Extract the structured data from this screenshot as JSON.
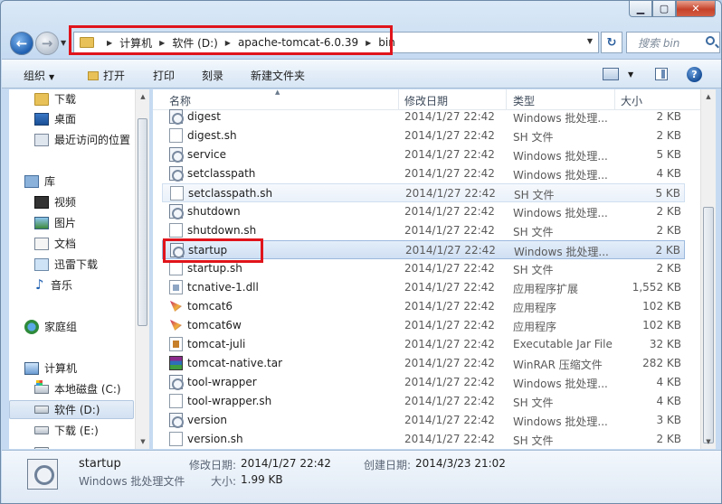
{
  "address": {
    "crumbs": [
      "计算机",
      "软件 (D:)",
      "apache-tomcat-6.0.39",
      "bin"
    ]
  },
  "search": {
    "placeholder": "搜索 bin"
  },
  "toolbar": {
    "organize": "组织",
    "open": "打开",
    "print": "打印",
    "burn": "刻录",
    "new_folder": "新建文件夹"
  },
  "sidebar": {
    "items": [
      {
        "label": "下载",
        "icon": "folder-icon"
      },
      {
        "label": "桌面",
        "icon": "desktop-icon"
      },
      {
        "label": "最近访问的位置",
        "icon": "recent-places-icon"
      },
      {
        "label": "库",
        "icon": "library-icon"
      },
      {
        "label": "视频",
        "icon": "video-icon"
      },
      {
        "label": "图片",
        "icon": "pictures-icon"
      },
      {
        "label": "文档",
        "icon": "documents-icon"
      },
      {
        "label": "迅雷下载",
        "icon": "thunder-download-icon"
      },
      {
        "label": "音乐",
        "icon": "music-icon"
      },
      {
        "label": "家庭组",
        "icon": "homegroup-icon"
      },
      {
        "label": "计算机",
        "icon": "computer-icon"
      },
      {
        "label": "本地磁盘 (C:)",
        "icon": "drive-c-icon"
      },
      {
        "label": "软件 (D:)",
        "icon": "drive-d-icon"
      },
      {
        "label": "下载 (E:)",
        "icon": "drive-e-icon"
      },
      {
        "label": "",
        "icon": "drive-icon"
      }
    ]
  },
  "columns": {
    "name": "名称",
    "modified": "修改日期",
    "type": "类型",
    "size": "大小"
  },
  "files": [
    {
      "name": "digest",
      "date": "2014/1/27 22:42",
      "type": "Windows 批处理...",
      "size": "2 KB",
      "icon": "batch-file-icon"
    },
    {
      "name": "digest.sh",
      "date": "2014/1/27 22:42",
      "type": "SH 文件",
      "size": "2 KB",
      "icon": "sh-file-icon"
    },
    {
      "name": "service",
      "date": "2014/1/27 22:42",
      "type": "Windows 批处理...",
      "size": "5 KB",
      "icon": "batch-file-icon"
    },
    {
      "name": "setclasspath",
      "date": "2014/1/27 22:42",
      "type": "Windows 批处理...",
      "size": "4 KB",
      "icon": "batch-file-icon"
    },
    {
      "name": "setclasspath.sh",
      "date": "2014/1/27 22:42",
      "type": "SH 文件",
      "size": "5 KB",
      "icon": "sh-file-icon"
    },
    {
      "name": "shutdown",
      "date": "2014/1/27 22:42",
      "type": "Windows 批处理...",
      "size": "2 KB",
      "icon": "batch-file-icon"
    },
    {
      "name": "shutdown.sh",
      "date": "2014/1/27 22:42",
      "type": "SH 文件",
      "size": "2 KB",
      "icon": "sh-file-icon"
    },
    {
      "name": "startup",
      "date": "2014/1/27 22:42",
      "type": "Windows 批处理...",
      "size": "2 KB",
      "icon": "batch-file-icon"
    },
    {
      "name": "startup.sh",
      "date": "2014/1/27 22:42",
      "type": "SH 文件",
      "size": "2 KB",
      "icon": "sh-file-icon"
    },
    {
      "name": "tcnative-1.dll",
      "date": "2014/1/27 22:42",
      "type": "应用程序扩展",
      "size": "1,552 KB",
      "icon": "dll-file-icon"
    },
    {
      "name": "tomcat6",
      "date": "2014/1/27 22:42",
      "type": "应用程序",
      "size": "102 KB",
      "icon": "tomcat-exe-icon"
    },
    {
      "name": "tomcat6w",
      "date": "2014/1/27 22:42",
      "type": "应用程序",
      "size": "102 KB",
      "icon": "tomcat-exe-icon"
    },
    {
      "name": "tomcat-juli",
      "date": "2014/1/27 22:42",
      "type": "Executable Jar File",
      "size": "32 KB",
      "icon": "jar-file-icon"
    },
    {
      "name": "tomcat-native.tar",
      "date": "2014/1/27 22:42",
      "type": "WinRAR 压缩文件",
      "size": "282 KB",
      "icon": "winrar-archive-icon"
    },
    {
      "name": "tool-wrapper",
      "date": "2014/1/27 22:42",
      "type": "Windows 批处理...",
      "size": "4 KB",
      "icon": "batch-file-icon"
    },
    {
      "name": "tool-wrapper.sh",
      "date": "2014/1/27 22:42",
      "type": "SH 文件",
      "size": "4 KB",
      "icon": "sh-file-icon"
    },
    {
      "name": "version",
      "date": "2014/1/27 22:42",
      "type": "Windows 批处理...",
      "size": "3 KB",
      "icon": "batch-file-icon"
    },
    {
      "name": "version.sh",
      "date": "2014/1/27 22:42",
      "type": "SH 文件",
      "size": "2 KB",
      "icon": "sh-file-icon"
    }
  ],
  "details": {
    "name": "startup",
    "type": "Windows 批处理文件",
    "modified_label": "修改日期:",
    "modified_value": "2014/1/27 22:42",
    "created_label": "创建日期:",
    "created_value": "2014/3/23 21:02",
    "size_label": "大小:",
    "size_value": "1.99 KB"
  },
  "colors": {
    "highlight_red": "#e0141b",
    "selection_blue": "#cfdff3"
  }
}
